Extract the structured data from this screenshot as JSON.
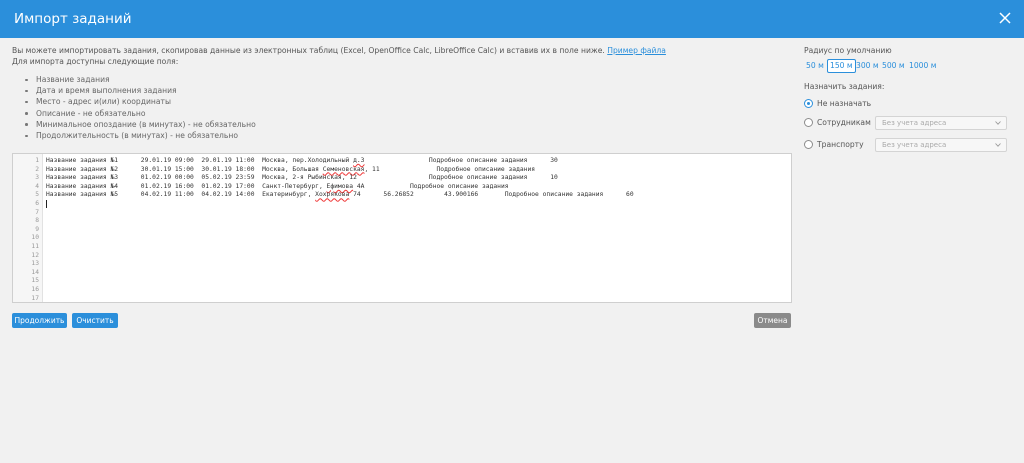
{
  "header": {
    "title": "Импорт заданий"
  },
  "intro": {
    "line1": "Вы можете импортировать задания, скопировав данные из электронных таблиц (Excel, OpenOffice Calc, LibreOffice Calc) и вставив их в поле ниже.",
    "example_link": "Пример файла",
    "line2": "Для импорта доступны следующие поля:"
  },
  "fields": [
    "Название задания",
    "Дата и время выполнения задания",
    "Место - адрес и(или) координаты",
    "Описание - не обязательно",
    "Минимальное опоздание (в минутах) - не обязательно",
    "Продолжительность (в минутах) - не обязательно"
  ],
  "editor": {
    "line_numbers": [
      "1",
      "2",
      "3",
      "4",
      "5",
      "6",
      "7",
      "8",
      "9",
      "10",
      "11",
      "12",
      "13",
      "14",
      "15",
      "16",
      "17"
    ],
    "lines": [
      {
        "a": "Название задания №1      29.01.19 09:00  29.01.19 11:00  Москва, пер.Холодильный ",
        "sp": "д.3",
        "b": "                 Подробное описание задания      30"
      },
      {
        "a": "Название задания №2      30.01.19 15:00  30.01.19 18:00  Москва, Большая ",
        "sp": "Семеновская",
        "b": ", 11               Подробное описание задания"
      },
      {
        "a": "Название задания №3      01.02.19 00:00  05.02.19 23:59  Москва, 2-я Рыбинская, 12                   Подробное описание задания      10",
        "sp": "",
        "b": ""
      },
      {
        "a": "Название задания №4      01.02.19 16:00  01.02.19 17:00  Санкт-Петербург, ",
        "sp": "Ефимова",
        "b": " 4А            Подробное описание задания"
      },
      {
        "a": "Название задания №5      04.02.19 11:00  04.02.19 14:00  Екатеринбург, ",
        "sp": "Хохрякова",
        "b": " 74      56.26852        43.900166       Подробное описание задания      60"
      }
    ]
  },
  "buttons": {
    "continue": "Продолжить",
    "clear": "Очистить",
    "cancel": "Отмена"
  },
  "radius": {
    "label": "Радиус по умолчанию",
    "options": [
      "50 м",
      "150 м",
      "300 м",
      "500 м",
      "1000 м"
    ],
    "selected": "150 м"
  },
  "assign": {
    "label": "Назначить задания:",
    "options": [
      {
        "label": "Не назначать",
        "checked": true
      },
      {
        "label": "Сотрудникам",
        "checked": false,
        "select": "Без учета адреса"
      },
      {
        "label": "Транспорту",
        "checked": false,
        "select": "Без учета адреса"
      }
    ]
  },
  "colors": {
    "header": "#2b8fdb",
    "accent": "#2b8fdb",
    "cancel": "#8a8a8a",
    "background": "#f1f1f1"
  },
  "icons": {
    "close": "close-icon",
    "select_arrow": "chevron-down-icon"
  }
}
